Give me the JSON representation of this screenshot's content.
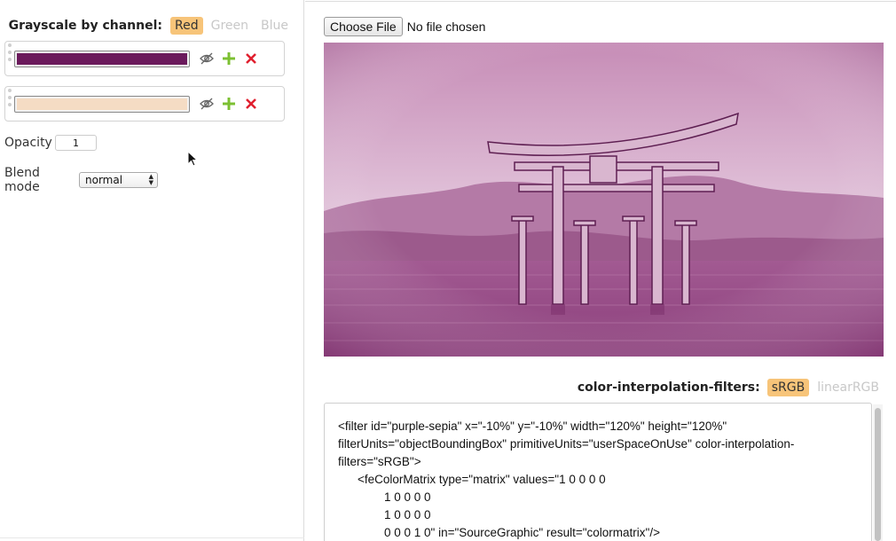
{
  "channel": {
    "label": "Grayscale by channel:",
    "options": [
      "Red",
      "Green",
      "Blue"
    ],
    "selected": "Red"
  },
  "layers": [
    {
      "color": "#6b1a5c",
      "visible": true
    },
    {
      "color": "#f5dcc4",
      "visible": true
    }
  ],
  "opacity": {
    "label": "Opacity",
    "value": "1"
  },
  "blend": {
    "label": "Blend mode",
    "value": "normal"
  },
  "file": {
    "button_label": "Choose File",
    "status": "No file chosen"
  },
  "image": {
    "tint": "#9a4a86",
    "subject": "torii-gate-in-water"
  },
  "color_interpolation": {
    "label": "color-interpolation-filters:",
    "options": [
      "sRGB",
      "linearRGB"
    ],
    "selected": "sRGB"
  },
  "code": {
    "lines": [
      "<filter id=\"purple-sepia\" x=\"-10%\" y=\"-10%\" width=\"120%\" height=\"120%\"",
      "filterUnits=\"objectBoundingBox\" primitiveUnits=\"userSpaceOnUse\" color-interpolation-",
      "filters=\"sRGB\">",
      "<feColorMatrix type=\"matrix\" values=\"1 0 0 0 0",
      "1 0 0 0 0",
      "1 0 0 0 0",
      "0 0 0 1 0\" in=\"SourceGraphic\" result=\"colormatrix\"/>"
    ]
  },
  "accent_color": "#f7c479"
}
